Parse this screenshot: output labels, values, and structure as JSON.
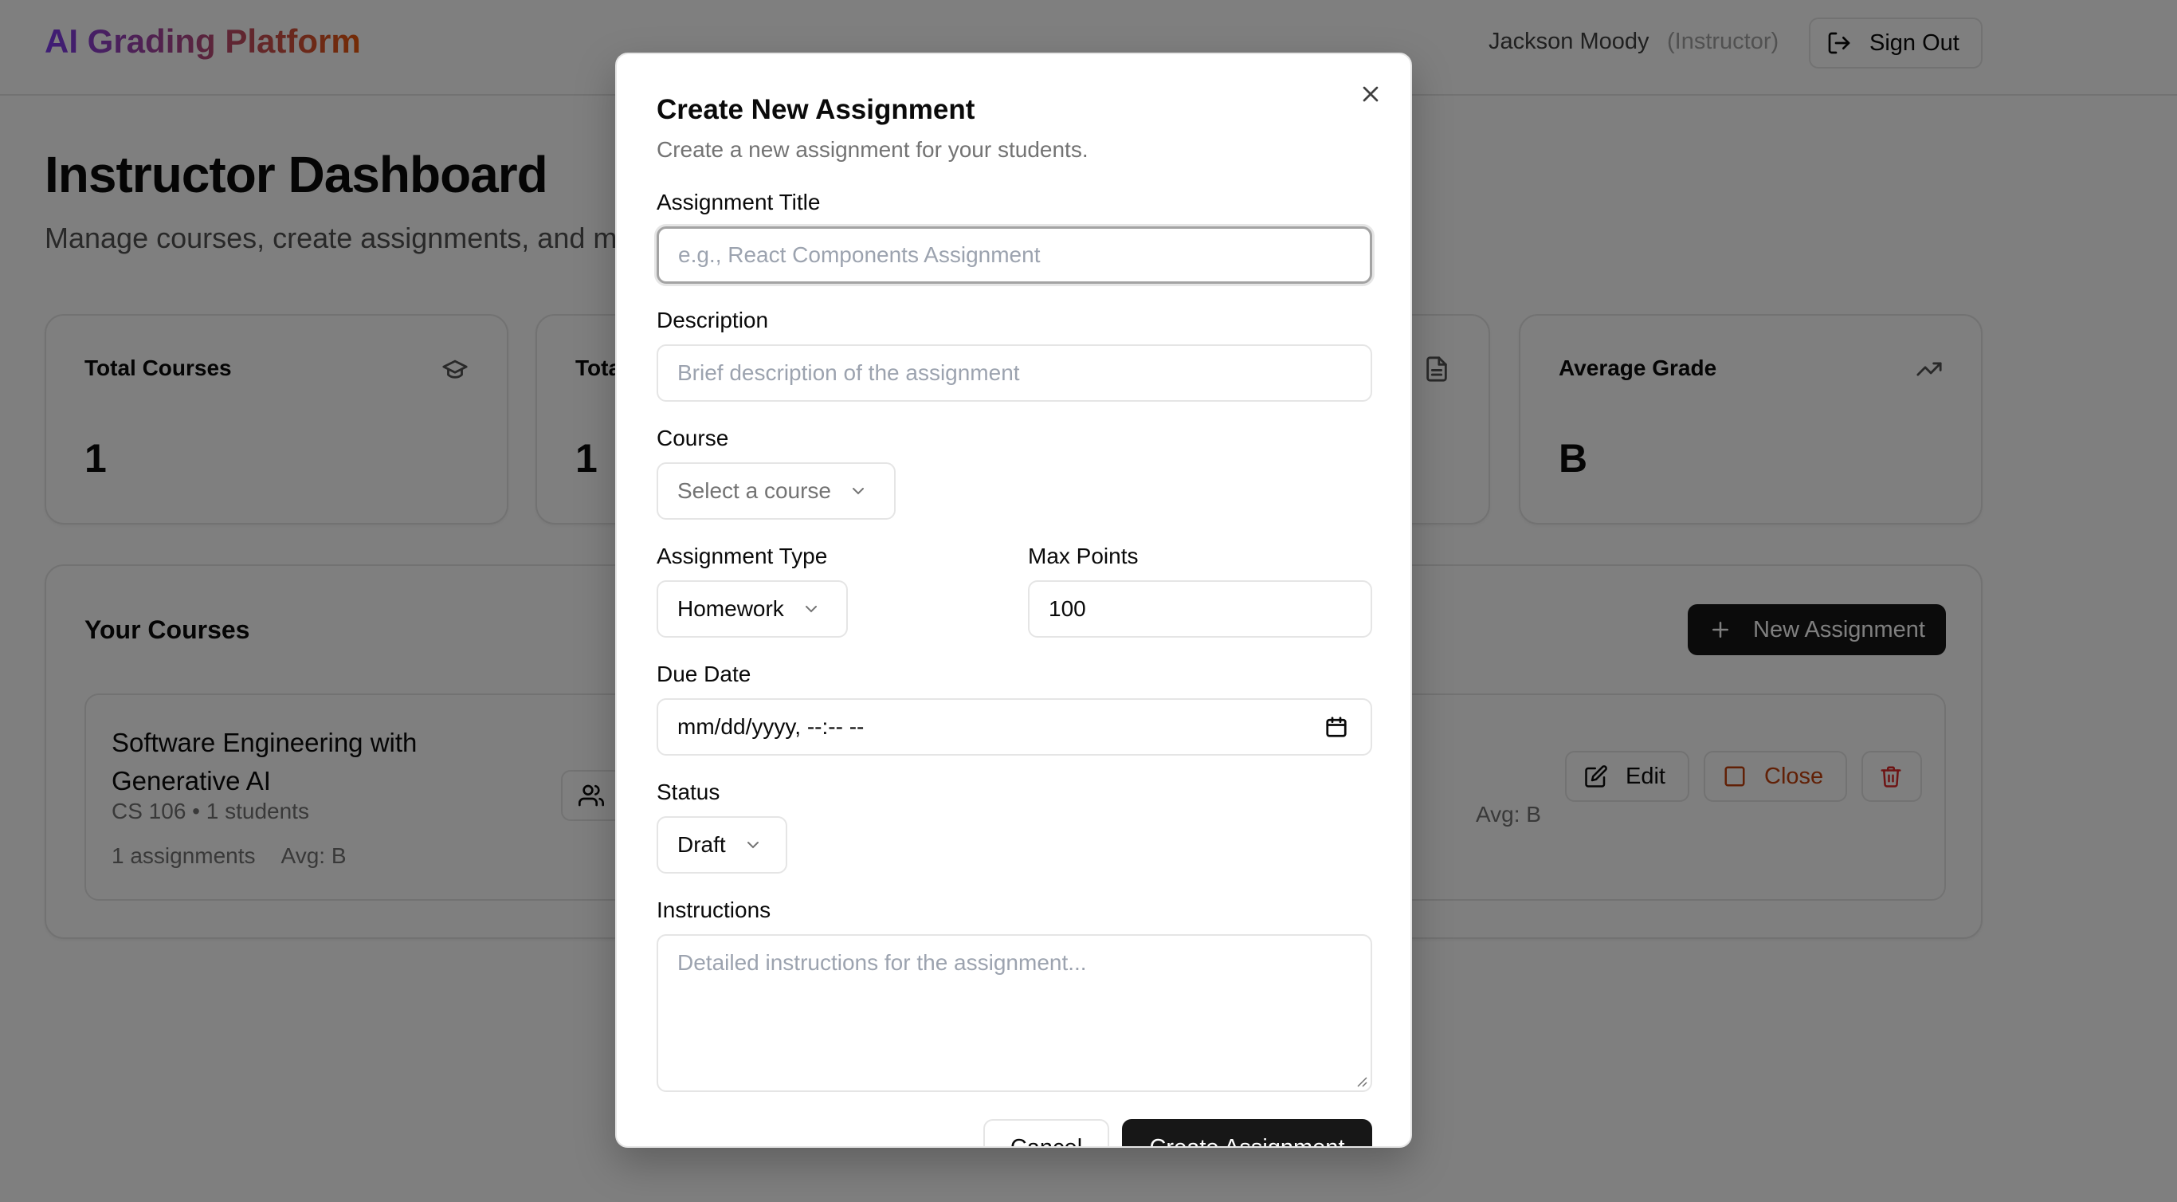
{
  "header": {
    "brand": "AI Grading Platform",
    "user_name": "Jackson Moody",
    "user_role": "(Instructor)",
    "signout_label": "Sign Out"
  },
  "dashboard": {
    "title": "Instructor Dashboard",
    "subtitle": "Manage courses, create assignments, and m",
    "stats": [
      {
        "label": "Total Courses",
        "value": "1",
        "icon": "graduation-cap-icon"
      },
      {
        "label": "Tota",
        "value": "1",
        "icon": "users-icon"
      },
      {
        "label": "",
        "value": "",
        "icon": "file-text-icon"
      },
      {
        "label": "Average Grade",
        "value": "B",
        "icon": "trending-up-icon"
      }
    ]
  },
  "courses": {
    "title": "Your Courses",
    "new_assignment_label": "New Assignment",
    "items": [
      {
        "name": "Software Engineering with Generative AI",
        "meta": "CS 106 • 1 students",
        "assignments": "1 assignments",
        "avg": "Avg: B",
        "avg_right": "Avg: B",
        "edit_label": "Edit",
        "close_label": "Close"
      }
    ]
  },
  "modal": {
    "title": "Create New Assignment",
    "description": "Create a new assignment for your students.",
    "fields": {
      "title_label": "Assignment Title",
      "title_placeholder": "e.g., React Components Assignment",
      "description_label": "Description",
      "description_placeholder": "Brief description of the assignment",
      "course_label": "Course",
      "course_placeholder": "Select a course",
      "type_label": "Assignment Type",
      "type_value": "Homework",
      "max_points_label": "Max Points",
      "max_points_value": "100",
      "due_date_label": "Due Date",
      "due_date_value": "mm/dd/yyyy, --:-- --",
      "status_label": "Status",
      "status_value": "Draft",
      "instructions_label": "Instructions",
      "instructions_placeholder": "Detailed instructions for the assignment..."
    },
    "cancel_label": "Cancel",
    "create_label": "Create Assignment"
  },
  "colors": {
    "brand_start": "#7c3aed",
    "brand_end": "#ea580c",
    "primary_button": "#171717",
    "close_action": "#c2410c",
    "delete_action": "#dc2626"
  }
}
